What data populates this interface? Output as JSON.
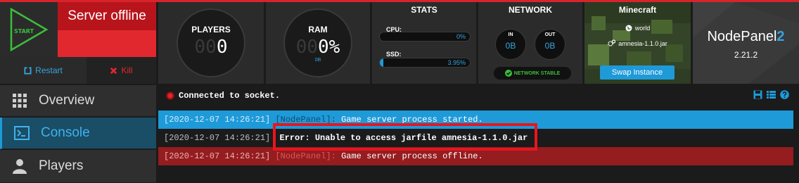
{
  "colors": {
    "accent": "#1e9ad9",
    "danger": "#e0282e",
    "success": "#3bbf3b"
  },
  "control": {
    "start_label": "START",
    "status": "Server offline",
    "restart_label": "Restart",
    "kill_label": "Kill"
  },
  "sidebar": {
    "items": [
      {
        "label": "Overview",
        "icon": "grid-icon"
      },
      {
        "label": "Console",
        "icon": "terminal-icon",
        "active": true
      },
      {
        "label": "Players",
        "icon": "user-icon"
      }
    ]
  },
  "players": {
    "title": "PLAYERS",
    "dim_digits": "00",
    "value": "0"
  },
  "ram": {
    "title": "RAM",
    "dim_digits": "00",
    "value": "0%",
    "sub": "0B"
  },
  "stats": {
    "title": "STATS",
    "cpu_label": "CPU:",
    "cpu_value": "0%",
    "cpu_percent": 0,
    "ssd_label": "SSD:",
    "ssd_value": "3.95%",
    "ssd_percent": 3.95
  },
  "network": {
    "title": "NETWORK",
    "in_label": "IN",
    "in_value": "0B",
    "out_label": "OUT",
    "out_value": "0B",
    "stable_label": "NETWORK STABLE"
  },
  "minecraft": {
    "title": "Minecraft",
    "world": "world",
    "jar": "amnesia-1.1.0.jar",
    "swap_label": "Swap Instance"
  },
  "nodepanel": {
    "name": "NodePanel",
    "number": "2",
    "version": "2.21.2"
  },
  "console": {
    "socket_status": "Connected to socket.",
    "lines": [
      {
        "timestamp": "[2020-12-07 14:26:21]",
        "source": "[NodePanel]:",
        "message": "Game server process started."
      },
      {
        "timestamp": "[2020-12-07 14:26:21]",
        "source": "",
        "message": "Error: Unable to access jarfile amnesia-1.1.0.jar"
      },
      {
        "timestamp": "[2020-12-07 14:26:21]",
        "source": "[NodePanel]:",
        "message": "Game server process offline."
      }
    ]
  }
}
